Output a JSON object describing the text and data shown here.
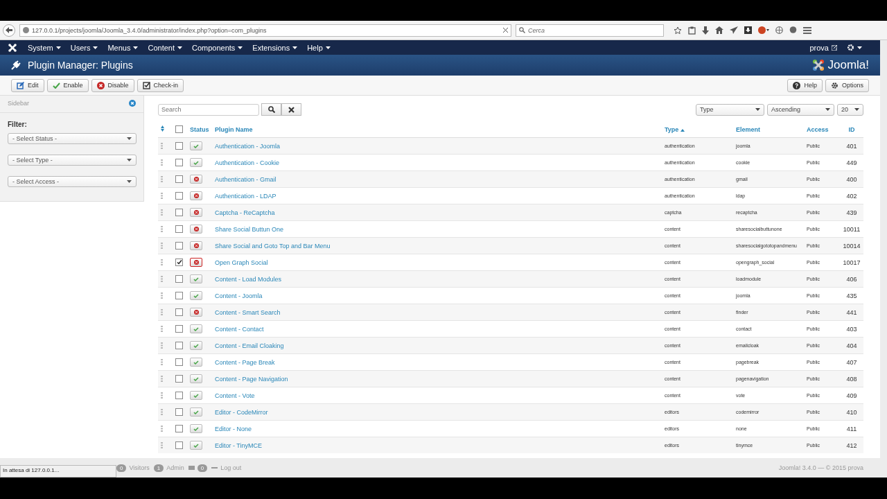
{
  "browser": {
    "url": "127.0.0.1/projects/joomla/Joomla_3.4.0/administrator/index.php?option=com_plugins",
    "search_placeholder": "Cerca"
  },
  "nav": {
    "menus": [
      "System",
      "Users",
      "Menus",
      "Content",
      "Components",
      "Extensions",
      "Help"
    ],
    "user": "prova"
  },
  "header": {
    "title": "Plugin Manager: Plugins",
    "logo": "Joomla!"
  },
  "toolbar": {
    "buttons": [
      {
        "label": "Edit",
        "kind": "edit"
      },
      {
        "label": "Enable",
        "kind": "enable"
      },
      {
        "label": "Disable",
        "kind": "disable"
      },
      {
        "label": "Check-in",
        "kind": "checkin"
      }
    ],
    "right_buttons": [
      {
        "label": "Help",
        "kind": "help"
      },
      {
        "label": "Options",
        "kind": "options"
      }
    ]
  },
  "sidebar": {
    "title": "Sidebar",
    "filter_label": "Filter:",
    "selects": [
      "- Select Status -",
      "- Select Type -",
      "- Select Access -"
    ]
  },
  "search": {
    "placeholder": "Search"
  },
  "sorting": {
    "field": "Type",
    "direction": "Ascending",
    "limit": "20"
  },
  "table": {
    "select_all_checked": false,
    "columns": [
      "Status",
      "Plugin Name",
      "Type",
      "Element",
      "Access",
      "ID"
    ],
    "rows": [
      {
        "checked": false,
        "enabled": true,
        "name": "Authentication - Joomla",
        "type": "authentication",
        "element": "joomla",
        "access": "Public",
        "id": "401"
      },
      {
        "checked": false,
        "enabled": true,
        "name": "Authentication - Cookie",
        "type": "authentication",
        "element": "cookie",
        "access": "Public",
        "id": "449"
      },
      {
        "checked": false,
        "enabled": false,
        "name": "Authentication - Gmail",
        "type": "authentication",
        "element": "gmail",
        "access": "Public",
        "id": "400"
      },
      {
        "checked": false,
        "enabled": false,
        "name": "Authentication - LDAP",
        "type": "authentication",
        "element": "ldap",
        "access": "Public",
        "id": "402"
      },
      {
        "checked": false,
        "enabled": false,
        "name": "Captcha - ReCaptcha",
        "type": "captcha",
        "element": "recaptcha",
        "access": "Public",
        "id": "439"
      },
      {
        "checked": false,
        "enabled": false,
        "name": "Share Social Buttun One",
        "type": "content",
        "element": "sharesocialbuttunone",
        "access": "Public",
        "id": "10011"
      },
      {
        "checked": false,
        "enabled": false,
        "name": "Share Social and Goto Top and Bar Menu",
        "type": "content",
        "element": "sharesocialgototopandmenu",
        "access": "Public",
        "id": "10014"
      },
      {
        "checked": true,
        "enabled": false,
        "name": "Open Graph Social",
        "type": "content",
        "element": "opengraph_social",
        "access": "Public",
        "id": "10017"
      },
      {
        "checked": false,
        "enabled": true,
        "name": "Content - Load Modules",
        "type": "content",
        "element": "loadmodule",
        "access": "Public",
        "id": "406"
      },
      {
        "checked": false,
        "enabled": true,
        "name": "Content - Joomla",
        "type": "content",
        "element": "joomla",
        "access": "Public",
        "id": "435"
      },
      {
        "checked": false,
        "enabled": false,
        "name": "Content - Smart Search",
        "type": "content",
        "element": "finder",
        "access": "Public",
        "id": "441"
      },
      {
        "checked": false,
        "enabled": true,
        "name": "Content - Contact",
        "type": "content",
        "element": "contact",
        "access": "Public",
        "id": "403"
      },
      {
        "checked": false,
        "enabled": true,
        "name": "Content - Email Cloaking",
        "type": "content",
        "element": "emailcloak",
        "access": "Public",
        "id": "404"
      },
      {
        "checked": false,
        "enabled": true,
        "name": "Content - Page Break",
        "type": "content",
        "element": "pagebreak",
        "access": "Public",
        "id": "407"
      },
      {
        "checked": false,
        "enabled": true,
        "name": "Content - Page Navigation",
        "type": "content",
        "element": "pagenavigation",
        "access": "Public",
        "id": "408"
      },
      {
        "checked": false,
        "enabled": true,
        "name": "Content - Vote",
        "type": "content",
        "element": "vote",
        "access": "Public",
        "id": "409"
      },
      {
        "checked": false,
        "enabled": true,
        "name": "Editor - CodeMirror",
        "type": "editors",
        "element": "codemirror",
        "access": "Public",
        "id": "410"
      },
      {
        "checked": false,
        "enabled": true,
        "name": "Editor - None",
        "type": "editors",
        "element": "none",
        "access": "Public",
        "id": "411"
      },
      {
        "checked": false,
        "enabled": true,
        "name": "Editor - TinyMCE",
        "type": "editors",
        "element": "tinymce",
        "access": "Public",
        "id": "412"
      }
    ]
  },
  "status_bar": {
    "visitors_count": "0",
    "visitors_label": "Visitors",
    "admin_count": "1",
    "admin_label": "Admin",
    "messages_count": "0",
    "logout": "Log out",
    "copyright": "Joomla! 3.4.0 — © 2015 prova"
  },
  "browser_status": "In attesa di 127.0.0.1..."
}
